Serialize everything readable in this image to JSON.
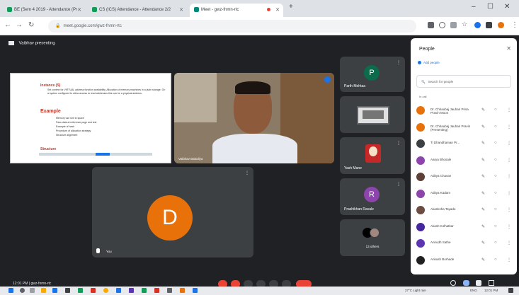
{
  "tabs": [
    {
      "label": "BE (Sem 4 2019 - Attendance (Pr",
      "active": false
    },
    {
      "label": "CS (ICS) Attendance - Attendance 2/2",
      "active": false
    },
    {
      "label": "Meet - gwz-fnmn-rtc",
      "active": true
    }
  ],
  "address": {
    "url": "meet.google.com/gwz-fnmn-rtc"
  },
  "meeting": {
    "presenting_label": "Vaibhav presenting",
    "code_label": "gwz-fnmn-rtc",
    "time": "12:01 PM"
  },
  "slide": {
    "heading1": "Instance (S)",
    "body": "Set context for VIRTUAL address function availability, Allocation of memory machines in a plain storage. On a system configured to allow access to read addresses this can be a physical address.",
    "heading2": "Example",
    "bullets": [
      "Memory use unit in space",
      "Pass data at reference page and test",
      "Example of hash",
      "Procedure of allocation strategy",
      "Structure alignment"
    ],
    "heading3": "Structure"
  },
  "tiles": {
    "presenter_name": "Vaibhav Babaliya",
    "main_avatar_letter": "D",
    "main_name": "You",
    "p_letter": "P",
    "p_name": "Parth Mehtaa",
    "r_letter": "R",
    "r_name": "Prashikhan Ravale",
    "yash_name": "Yash Mane",
    "others_name": "13 others"
  },
  "people_panel": {
    "title": "People",
    "add_label": "Add people",
    "search_placeholder": "Search for people",
    "section_label": "In call",
    "participants": [
      {
        "name": "Dr. Chhaubaj Jauhari Prisa Pravin Moon",
        "color": "#e8710a"
      },
      {
        "name": "Dr. Chhaubaj Jauhari Pravin (Presenting)",
        "color": "#e8710a"
      },
      {
        "name": "Ti Dhandhaman Pr...",
        "color": "#3c4043"
      },
      {
        "name": "Aarya Bhosale",
        "color": "#8e44ad"
      },
      {
        "name": "Aditya Chavan",
        "color": "#5d4037"
      },
      {
        "name": "Aditya Kadam",
        "color": "#8e44ad"
      },
      {
        "name": "Akanksha Tayade",
        "color": "#6d4c41"
      },
      {
        "name": "Akash Kolhatkar",
        "color": "#4527a0"
      },
      {
        "name": "Anirudh Sathe",
        "color": "#5e35b1"
      },
      {
        "name": "Ankush Borhade",
        "color": "#212121"
      }
    ]
  },
  "taskbar": {
    "weather": "27°C Light rain",
    "clock": "12:01 PM",
    "lang": "ENG"
  },
  "colors": {
    "meet_bg": "#202124",
    "tile_bg": "#3c4043",
    "end_call": "#ea4335",
    "avatar_d": "#e8710a",
    "avatar_p": "#0b6b4a",
    "avatar_r": "#8e44ad",
    "accent": "#1a73e8"
  }
}
